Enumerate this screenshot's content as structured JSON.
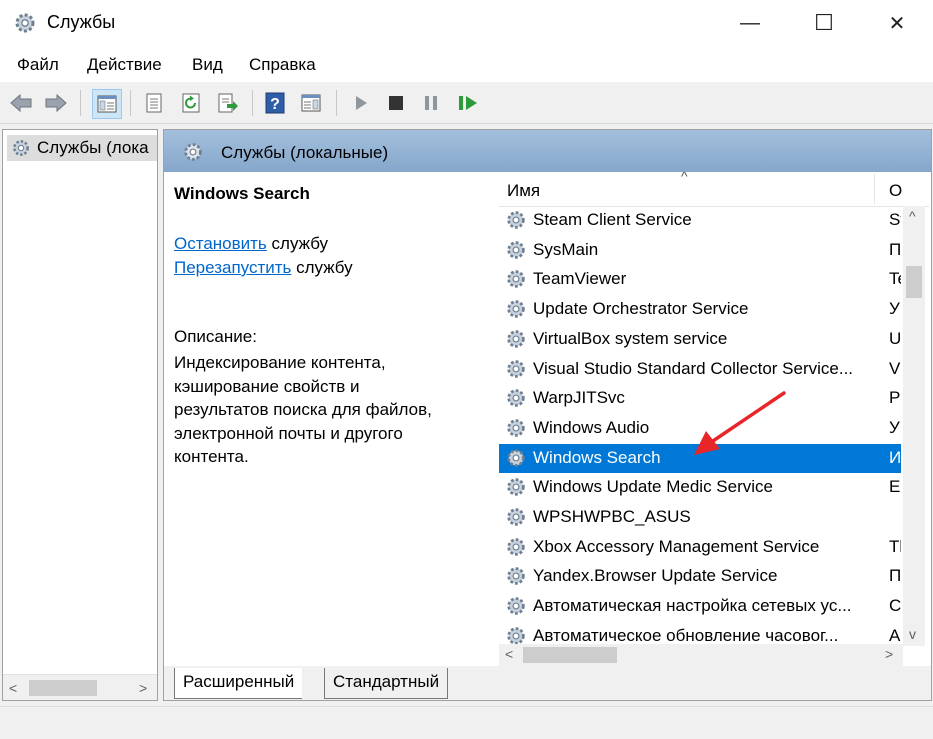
{
  "window": {
    "title": "Службы",
    "minimize_glyph": "—",
    "maximize_glyph": "☐",
    "close_glyph": "✕"
  },
  "menu": [
    "Файл",
    "Действие",
    "Вид",
    "Справка"
  ],
  "toolbar_icons": [
    "back-arrow-icon",
    "forward-arrow-icon",
    "show-console-tree-icon",
    "properties-icon",
    "refresh-icon",
    "export-list-icon",
    "help-icon",
    "show-hide-action-pane-icon",
    "start-service-icon",
    "stop-service-icon",
    "pause-service-icon",
    "restart-service-icon"
  ],
  "tree": {
    "item_label": "Службы (лока"
  },
  "pane_header": {
    "title": "Службы (локальные)"
  },
  "details": {
    "service_name": "Windows Search",
    "stop_link": "Остановить",
    "stop_suffix": " службу",
    "restart_link": "Перезапустить",
    "restart_suffix": " службу",
    "description_label": "Описание:",
    "description_lines": [
      "Индексирование контента,",
      "кэширование свойств и",
      "результатов поиска для файлов,",
      "электронной почты и другого",
      "контента."
    ]
  },
  "list": {
    "col_name": "Имя",
    "col_desc": "О",
    "rows": [
      {
        "name": "Steam Client Service",
        "desc": "St",
        "selected": false
      },
      {
        "name": "SysMain",
        "desc": "П",
        "selected": false
      },
      {
        "name": "TeamViewer",
        "desc": "Te",
        "selected": false
      },
      {
        "name": "Update Orchestrator Service",
        "desc": "У",
        "selected": false
      },
      {
        "name": "VirtualBox system service",
        "desc": "U",
        "selected": false
      },
      {
        "name": "Visual Studio Standard Collector Service...",
        "desc": "Vi",
        "selected": false
      },
      {
        "name": "WarpJITSvc",
        "desc": "Pr",
        "selected": false
      },
      {
        "name": "Windows Audio",
        "desc": "У",
        "selected": false
      },
      {
        "name": "Windows Search",
        "desc": "И",
        "selected": true
      },
      {
        "name": "Windows Update Medic Service",
        "desc": "Er",
        "selected": false
      },
      {
        "name": "WPSHWPBC_ASUS",
        "desc": "",
        "selected": false
      },
      {
        "name": "Xbox Accessory Management Service",
        "desc": "Th",
        "selected": false
      },
      {
        "name": "Yandex.Browser Update Service",
        "desc": "П",
        "selected": false
      },
      {
        "name": "Автоматическая настройка сетевых ус...",
        "desc": "С.",
        "selected": false
      },
      {
        "name": "Автоматическое обновление часовог...",
        "desc": "А",
        "selected": false
      }
    ]
  },
  "tabs": {
    "extended": "Расширенный",
    "standard": "Стандартный"
  },
  "colors": {
    "selection": "#0078d7",
    "link": "#0066cc",
    "annotation_arrow": "#e8262a"
  }
}
